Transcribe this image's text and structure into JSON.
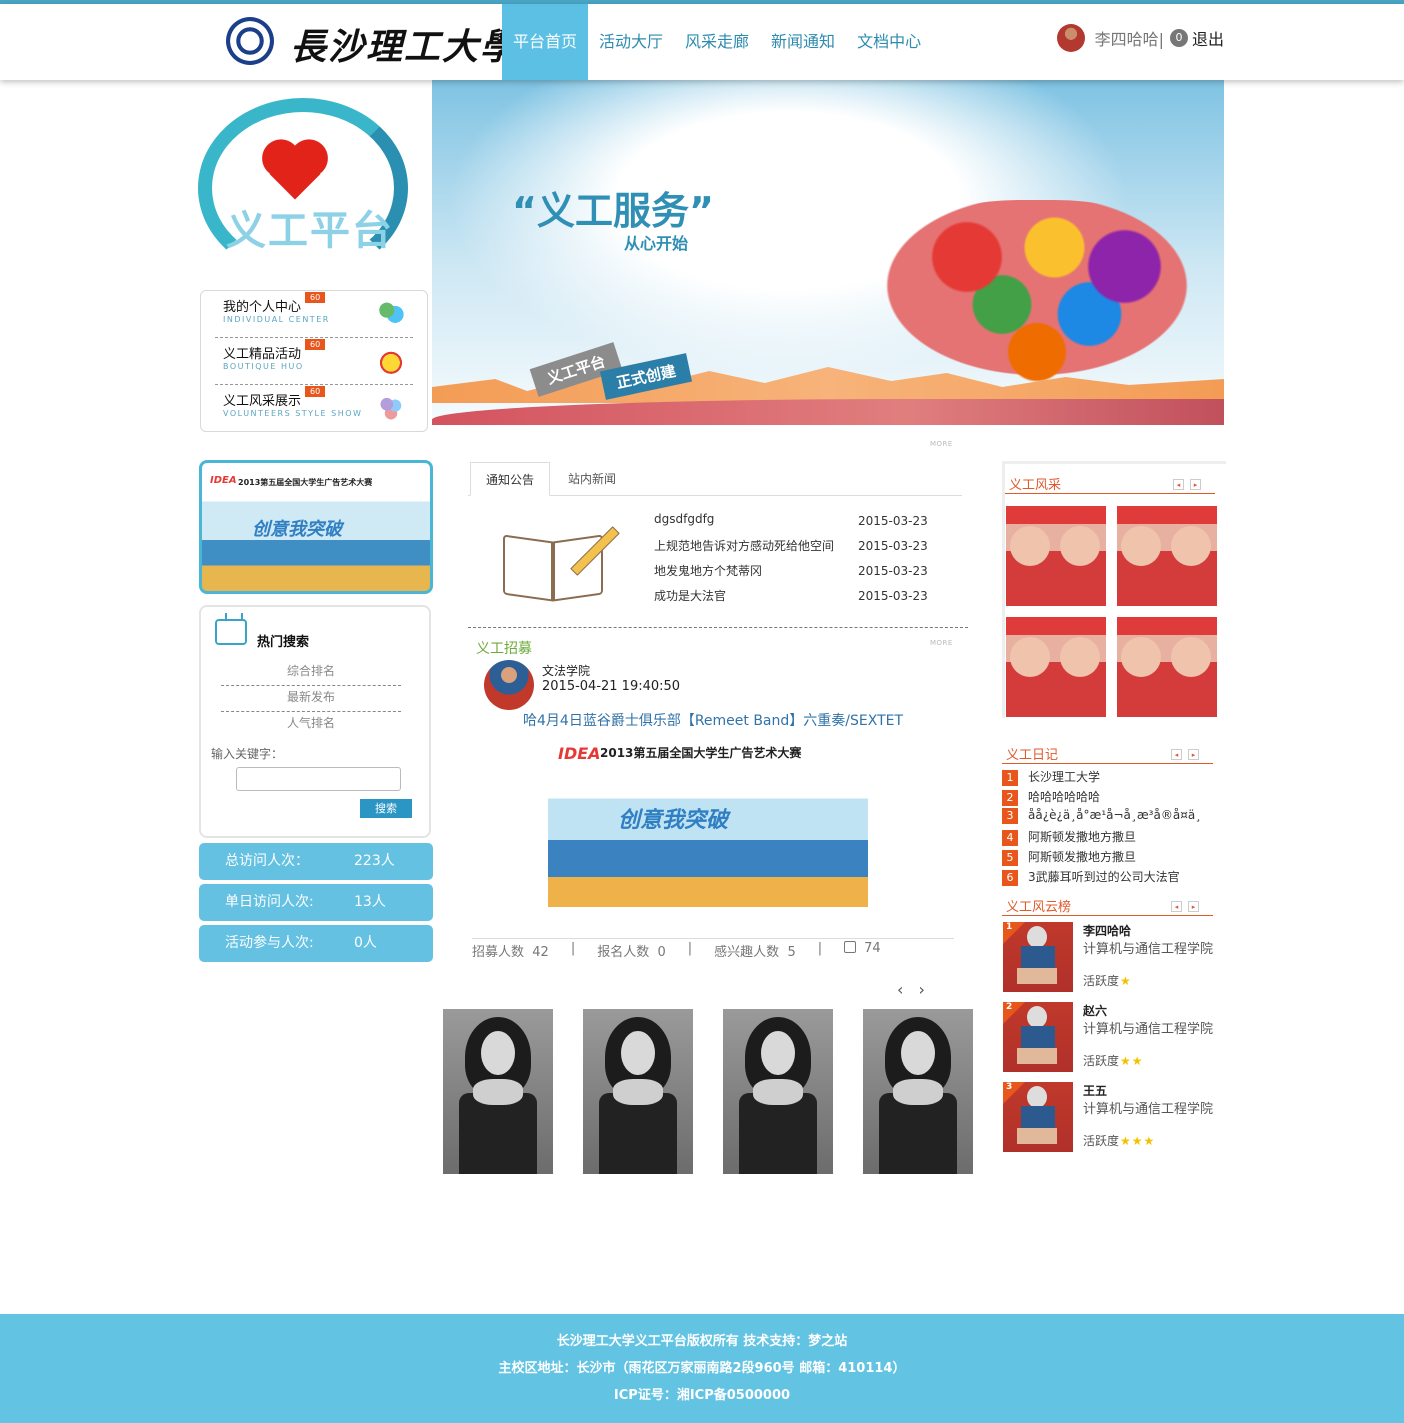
{
  "header": {
    "school_name": "長沙理工大學",
    "nav": [
      "平台首页",
      "活动大厅",
      "风采走廊",
      "新闻通知",
      "文档中心"
    ],
    "user_name": "李四哈哈|",
    "message_count": "0",
    "logout": "退出"
  },
  "banner": {
    "platform_text": "义工平台",
    "slogan": "“义工服务”",
    "slogan_sub": "从心开始",
    "ribbon1": "义工平台",
    "ribbon2": "正式创建"
  },
  "sidebar": {
    "menu": [
      {
        "title": "我的个人中心",
        "en": "INDIVIDUAL CENTER",
        "count": "60",
        "icon": "people-icon"
      },
      {
        "title": "义工精品活动",
        "en": "BOUTIQUE HUO",
        "count": "60",
        "icon": "medal-icon"
      },
      {
        "title": "义工风采展示",
        "en": "VOLUNTEERS STYLE SHOW",
        "count": "60",
        "icon": "balls-icon"
      }
    ],
    "promo": {
      "logo": "IDEA",
      "title": "2013第五届全国大学生广告艺术大赛",
      "slogan": "创意我突破"
    },
    "hot_search": {
      "title": "热门搜索",
      "links": [
        "综合排名",
        "最新发布",
        "人气排名"
      ],
      "keyword_label": "输入关键字：",
      "keyword_value": "",
      "button": "搜索"
    },
    "stats": [
      {
        "label": "总访问人次：",
        "value": "223人"
      },
      {
        "label": "单日访问人次:",
        "value": "13人"
      },
      {
        "label": "活动参与人次:",
        "value": "0人"
      }
    ]
  },
  "center": {
    "more": "MORE",
    "tabs": [
      "通知公告",
      "站内新闻"
    ],
    "notices": [
      {
        "title": "dgsdfgdfg",
        "date": "2015-03-23"
      },
      {
        "title": "上规范地告诉对方感动死给他空间",
        "date": "2015-03-23"
      },
      {
        "title": "地发鬼地方个梵蒂冈",
        "date": "2015-03-23"
      },
      {
        "title": "成功是大法官",
        "date": "2015-03-23"
      }
    ],
    "recruit": {
      "section_title": "义工招募",
      "org": "文法学院",
      "time": "2015-04-21 19:40:50",
      "headline": "哈4月4日蓝谷爵士俱乐部【Remeet Band】六重奏/SEXTET",
      "poster_title": "2013第五届全国大学生广告艺术大赛",
      "poster_slogan": "创意我突破",
      "poster_logo": "IDEA",
      "stats": {
        "recruit_label": "招募人数",
        "recruit_value": "42",
        "signup_label": "报名人数",
        "signup_value": "0",
        "interest_label": "感兴趣人数",
        "interest_value": "5",
        "likes": "74",
        "separator": "|"
      }
    },
    "carousel_prev": "‹",
    "carousel_next": "›"
  },
  "right": {
    "style_title": "义工风采",
    "diary_title": "义工日记",
    "diary": [
      {
        "num": "1",
        "text": "长沙理工大学"
      },
      {
        "num": "2",
        "text": "哈哈哈哈哈哈"
      },
      {
        "num": "3",
        "text": "åå¿è¿ä¸å°æ¹å¬å¸æ³å®å¤ä¸"
      },
      {
        "num": "4",
        "text": "阿斯顿发撒地方撒旦"
      },
      {
        "num": "5",
        "text": "阿斯顿发撒地方撒旦"
      },
      {
        "num": "6",
        "text": "3武藤耳听到过的公司大法官"
      }
    ],
    "rank_title": "义工风云榜",
    "activity_label": "活跃度",
    "ranks": [
      {
        "num": "1",
        "name": "李四哈哈",
        "dept": "计算机与通信工程学院",
        "stars": 1
      },
      {
        "num": "2",
        "name": "赵六",
        "dept": "计算机与通信工程学院",
        "stars": 2
      },
      {
        "num": "3",
        "name": "王五",
        "dept": "计算机与通信工程学院",
        "stars": 3
      }
    ],
    "arrow_prev": "◂",
    "arrow_next": "▸"
  },
  "footer": {
    "line1": "长沙理工大学义工平台版权所有  技术支持：梦之站",
    "line2": "主校区地址：长沙市（雨花区万家丽南路2段960号 邮箱：410114）",
    "line3": "ICP证号：湘ICP备0500000"
  }
}
